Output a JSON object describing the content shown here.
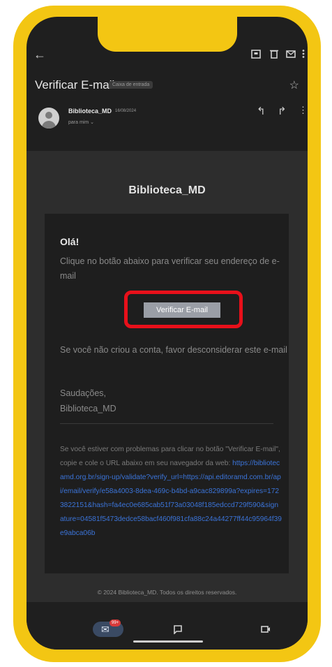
{
  "header": {
    "subject": "Verificar E-mail",
    "label_chip": "Caixa de entrada"
  },
  "sender": {
    "name": "Biblioteca_MD",
    "date": "16/08/2024",
    "to": "para mim ⌄"
  },
  "email": {
    "brand": "Biblioteca_MD",
    "greeting": "Olá!",
    "intro": "Clique no botão abaixo para verificar seu endereço de e-mail",
    "button_label": "Verificar E-mail",
    "note": "Se você não criou a conta, favor desconsiderar este e-mail",
    "regards_line1": "Saudações,",
    "regards_line2": "Biblioteca_MD",
    "trouble_text": "Se você estiver com problemas para clicar no botão \"Verificar E-mail\", copie e cole o URL abaixo em seu navegador da web:",
    "trouble_link": "https://bibliotecamd.org.br/sign-up/validate?verify_url=https://api.editoramd.com.br/api/email/verify/e58a4003-8dea-469c-b4bd-a9cac829899a?expires=1723822151&hash=fa4ec0e685cab51f73a03048f185edccd729f590&signature=04581f5473dedce58bacf460f981cfa88c24a44277ff44c95964f39e9abca06b",
    "footer": "© 2024 Biblioteca_MD. Todos os direitos reservados."
  },
  "nav": {
    "mail_badge": "99+"
  },
  "colors": {
    "frame": "#f3c613",
    "highlight": "#e8101a",
    "link": "#3b74d9"
  },
  "icons": [
    "back-arrow-icon",
    "archive-icon",
    "delete-icon",
    "mark-unread-icon",
    "more-vert-icon",
    "star-icon",
    "reply-icon",
    "forward-icon",
    "mail-icon",
    "chat-icon",
    "meet-icon"
  ]
}
